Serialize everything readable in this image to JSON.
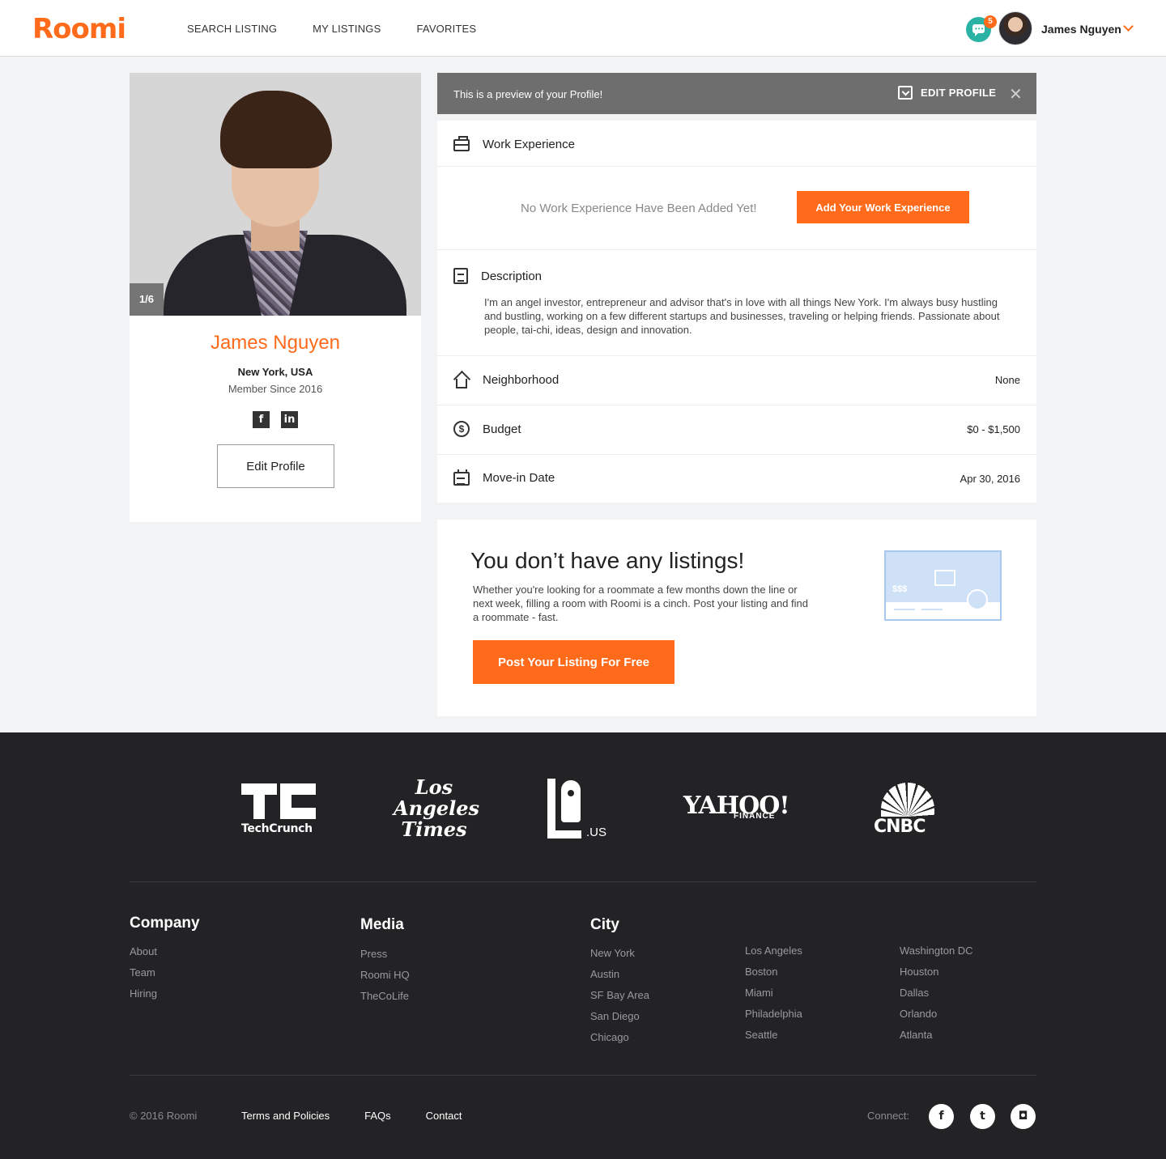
{
  "header": {
    "logo": "Roomi",
    "nav": [
      "SEARCH LISTING",
      "MY LISTINGS",
      "FAVORITES"
    ],
    "notification_count": "5",
    "user_name": "James Nguyen",
    "accent_color": "#ff6b1a",
    "chat_color": "#2ab3a5"
  },
  "profile": {
    "photo_counter": "1/6",
    "name": "James Nguyen",
    "location": "New York, USA",
    "member_since": "Member Since 2016",
    "social_icons": [
      "facebook-icon",
      "linkedin-icon"
    ],
    "edit_button": "Edit Profile"
  },
  "preview": {
    "message": "This is a preview of your Profile!",
    "edit_label": "EDIT PROFILE",
    "close_glyph": "✕"
  },
  "details": {
    "work": {
      "title": "Work Experience",
      "empty_text": "No Work Experience Have Been Added Yet!",
      "add_button": "Add Your Work Experience"
    },
    "description": {
      "title": "Description",
      "text": "I'm an angel investor, entrepreneur and advisor that's in love with all things New York. I'm always busy hustling and bustling, working on a few different startups and businesses, traveling or helping friends. Passionate about people, tai-chi, ideas, design and innovation."
    },
    "neighborhood": {
      "label": "Neighborhood",
      "value": "None"
    },
    "budget": {
      "label": "Budget",
      "value": "$0 - $1,500"
    },
    "move_in": {
      "label": "Move-in Date",
      "value": "Apr 30, 2016"
    }
  },
  "listings": {
    "title": "You don’t have any listings!",
    "text": "Whether you're looking for a roommate a few months down the line or next week, filling a room with Roomi is a cinch. Post your listing and find a roommate - fast.",
    "button": "Post Your Listing For Free",
    "illustration_price": "$$$"
  },
  "footer": {
    "press": {
      "techcrunch": "TechCrunch",
      "la_times_lines": [
        "Los",
        "Angeles",
        "Times"
      ],
      "la_us": ".US",
      "yahoo": "YAHOO!",
      "yahoo_sub": "FINANCE",
      "cnbc": "CNBC"
    },
    "company": {
      "title": "Company",
      "items": [
        "About",
        "Team",
        "Hiring"
      ]
    },
    "media": {
      "title": "Media",
      "items": [
        "Press",
        "Roomi HQ",
        "TheCoLife"
      ]
    },
    "city": {
      "title": "City",
      "col1": [
        "New York",
        "Austin",
        "SF Bay Area",
        "San Diego",
        "Chicago"
      ],
      "col2": [
        "Los Angeles",
        "Boston",
        "Miami",
        "Philadelphia",
        "Seattle"
      ],
      "col3": [
        "Washington DC",
        "Houston",
        "Dallas",
        "Orlando",
        "Atlanta"
      ]
    },
    "copyright": "© 2016 Roomi",
    "links": [
      "Terms and Policies",
      "FAQs",
      "Contact"
    ],
    "connect_label": "Connect:",
    "social": [
      "facebook-icon",
      "twitter-icon",
      "instagram-icon"
    ]
  }
}
